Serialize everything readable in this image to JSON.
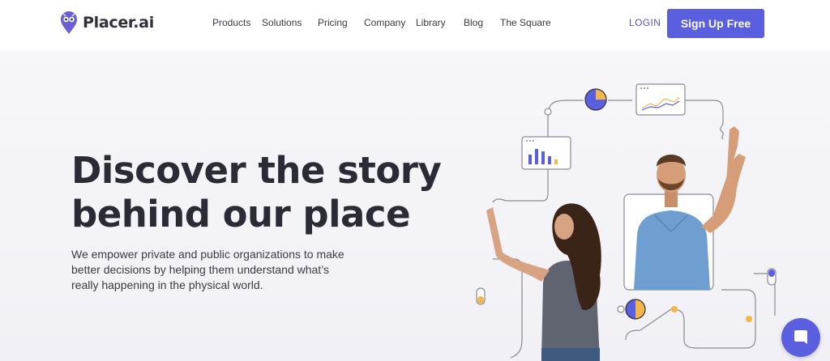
{
  "brand": {
    "name": "Placer.ai",
    "accent": "#5a5fe0"
  },
  "nav": {
    "items": [
      {
        "label": "Products"
      },
      {
        "label": "Solutions"
      },
      {
        "label": "Pricing"
      },
      {
        "label": "Company"
      },
      {
        "label": "Library"
      },
      {
        "label": "Blog"
      },
      {
        "label": "The Square"
      }
    ],
    "login": "LOGIN",
    "signup": "Sign Up Free"
  },
  "hero": {
    "headline_line1": "Discover the story",
    "headline_line2": "behind our place",
    "subtext": "We empower private and public organizations to make better decisions by helping them understand what’s really happening in the physical world."
  },
  "icons": {
    "logo": "owl-pin-icon",
    "chat": "chat-bubble-icon"
  }
}
